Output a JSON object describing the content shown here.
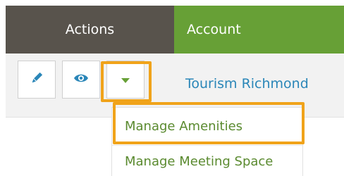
{
  "header": {
    "actions_label": "Actions",
    "account_label": "Account"
  },
  "row": {
    "account_name": "Tourism Richmond"
  },
  "buttons": [
    {
      "name": "edit",
      "icon": "pencil-icon"
    },
    {
      "name": "view",
      "icon": "eye-icon"
    },
    {
      "name": "more",
      "icon": "caret-down-icon"
    }
  ],
  "dropdown": {
    "items": [
      "Manage Amenities",
      "Manage Meeting Space"
    ]
  },
  "colors": {
    "actions_header_bg": "#58534c",
    "account_header_bg": "#67a036",
    "icon_blue": "#2a86b8",
    "link_blue": "#2a86b8",
    "menu_text_green": "#5a8a2f",
    "highlight_orange": "#f0a31a"
  }
}
